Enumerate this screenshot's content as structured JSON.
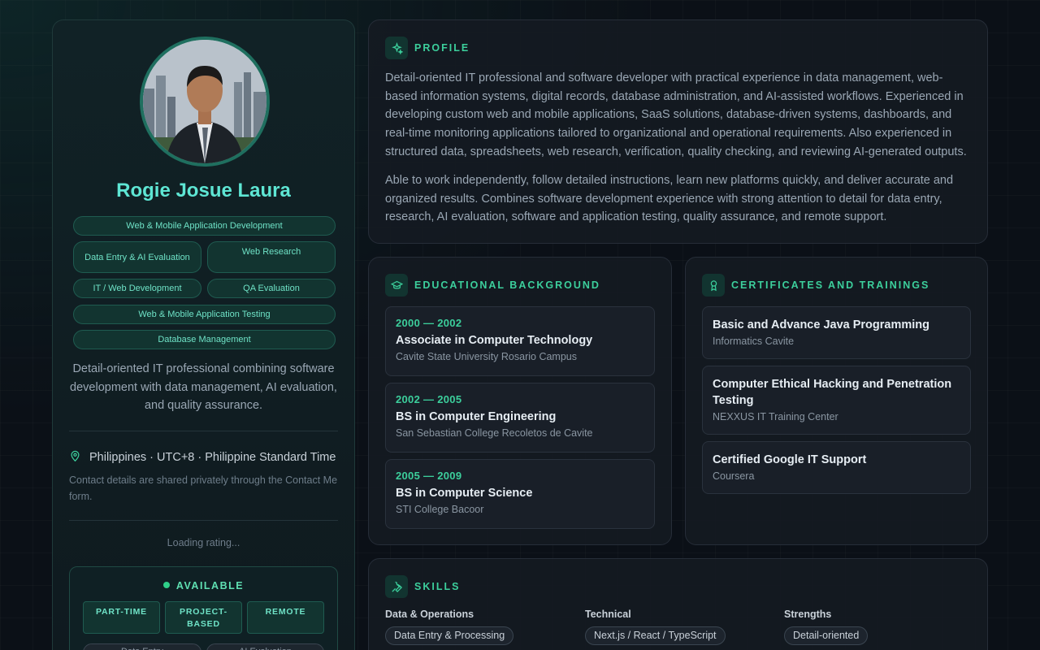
{
  "sidebar": {
    "name": "Rogie Josue Laura",
    "tags": [
      "Web & Mobile Application Development",
      "Data Entry & AI Evaluation",
      "Web Research",
      "IT / Web Development",
      "QA Evaluation",
      "Web & Mobile Application Testing",
      "Database Management"
    ],
    "bio": "Detail-oriented IT professional combining software development with data management, AI evaluation, and quality assurance.",
    "location": "Philippines · UTC+8 · Philippine Standard Time",
    "contact_note": "Contact details are shared privately through the Contact Me form.",
    "rating_status": "Loading rating...",
    "availability": {
      "status": "AVAILABLE",
      "types": [
        "PART-TIME",
        "PROJECT-BASED",
        "REMOTE"
      ],
      "roles": [
        "Data Entry",
        "AI Evaluation"
      ]
    }
  },
  "profile": {
    "title": "PROFILE",
    "paragraphs": [
      "Detail-oriented IT professional and software developer with practical experience in data management, web-based information systems, digital records, database administration, and AI-assisted workflows. Experienced in developing custom web and mobile applications, SaaS solutions, database-driven systems, dashboards, and real-time monitoring applications tailored to organizational and operational requirements. Also experienced in structured data, spreadsheets, web research, verification, quality checking, and reviewing AI-generated outputs.",
      "Able to work independently, follow detailed instructions, learn new platforms quickly, and deliver accurate and organized results. Combines software development experience with strong attention to detail for data entry, research, AI evaluation, software and application testing, quality assurance, and remote support."
    ]
  },
  "education": {
    "title": "EDUCATIONAL BACKGROUND",
    "items": [
      {
        "years": "2000 — 2002",
        "degree": "Associate in Computer Technology",
        "school": "Cavite State University Rosario Campus"
      },
      {
        "years": "2002 — 2005",
        "degree": "BS in Computer Engineering",
        "school": "San Sebastian College Recoletos de Cavite"
      },
      {
        "years": "2005 — 2009",
        "degree": "BS in Computer Science",
        "school": "STI College Bacoor"
      }
    ]
  },
  "certificates": {
    "title": "CERTIFICATES AND TRAININGS",
    "items": [
      {
        "name": "Basic and Advance Java Programming",
        "issuer": "Informatics Cavite"
      },
      {
        "name": "Computer Ethical Hacking and Penetration Testing",
        "issuer": "NEXXUS IT Training Center"
      },
      {
        "name": "Certified Google IT Support",
        "issuer": "Coursera"
      }
    ]
  },
  "skills": {
    "title": "SKILLS",
    "columns": [
      {
        "title": "Data & Operations",
        "chips": [
          "Data Entry & Processing"
        ]
      },
      {
        "title": "Technical",
        "chips": [
          "Next.js / React / TypeScript"
        ]
      },
      {
        "title": "Strengths",
        "chips": [
          "Detail-oriented"
        ]
      }
    ]
  },
  "colors": {
    "accent": "#3ccf9c",
    "name": "#5ee6d4",
    "background": "#0b1017",
    "available_dot": "#2fd089"
  }
}
